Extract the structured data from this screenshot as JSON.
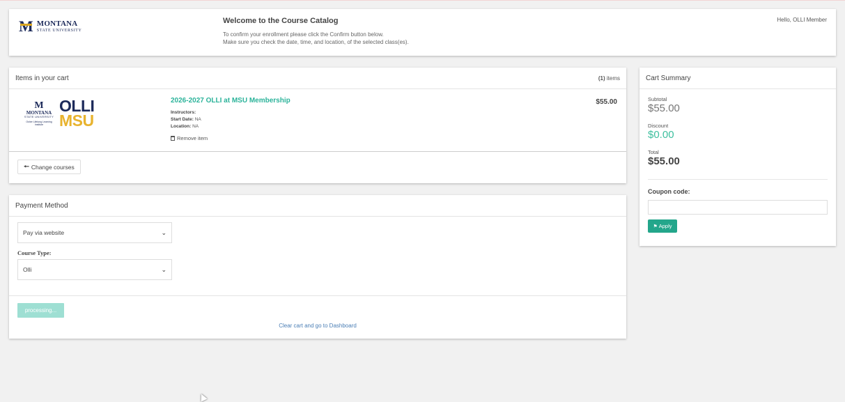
{
  "header": {
    "logo_line1": "MONTANA",
    "logo_line2": "STATE UNIVERSITY",
    "welcome_title": "Welcome to the Course Catalog",
    "welcome_line1": "To confirm your enrollment please click the Confirm button below.",
    "welcome_line2": "Make sure you check the date, time, and location, of the selected class(es).",
    "greeting": "Hello, OLLI Member"
  },
  "cart": {
    "title": "Items in your cart",
    "count_number": "(1)",
    "count_suffix": " items",
    "item": {
      "logo_msu_top": "MONTANA",
      "logo_msu_bottom": "STATE UNIVERSITY",
      "logo_msu_sub": "Osher Lifelong Learning Institute",
      "logo_olli": "OLLI",
      "logo_msu": "MSU",
      "title": "2026-2027 OLLI at MSU Membership",
      "instructors_label": "Instructors:",
      "instructors_value": "",
      "start_date_label": "Start Date:",
      "start_date_value": "NA",
      "location_label": "Location:",
      "location_value": "NA",
      "remove_label": "Remove item",
      "price": "$55.00"
    },
    "change_courses_label": "Change courses"
  },
  "payment": {
    "title": "Payment Method",
    "method_selected": "Pay via website",
    "course_type_label": "Course Type:",
    "course_type_selected": "Olli",
    "processing_label": "processing...",
    "clear_cart_label": "Clear cart and go to Dashboard"
  },
  "summary": {
    "title": "Cart Summary",
    "subtotal_label": "Subtotal",
    "subtotal_value": "$55.00",
    "discount_label": "Discount",
    "discount_value": "$0.00",
    "total_label": "Total",
    "total_value": "$55.00",
    "coupon_label": "Coupon code:",
    "coupon_value": "",
    "apply_label": "Apply"
  },
  "colors": {
    "accent_teal": "#2bb39a",
    "apply_green": "#23a68b",
    "processing_disabled": "#9edfd3",
    "msu_navy": "#1c2a5a",
    "msu_gold": "#e8b32e",
    "link_blue": "#4a7eb5"
  },
  "icons": {
    "arrow": "arrow-left-icon",
    "trash": "trash-icon",
    "tag": "tag-icon",
    "chevron": "chevron-down-icon"
  }
}
